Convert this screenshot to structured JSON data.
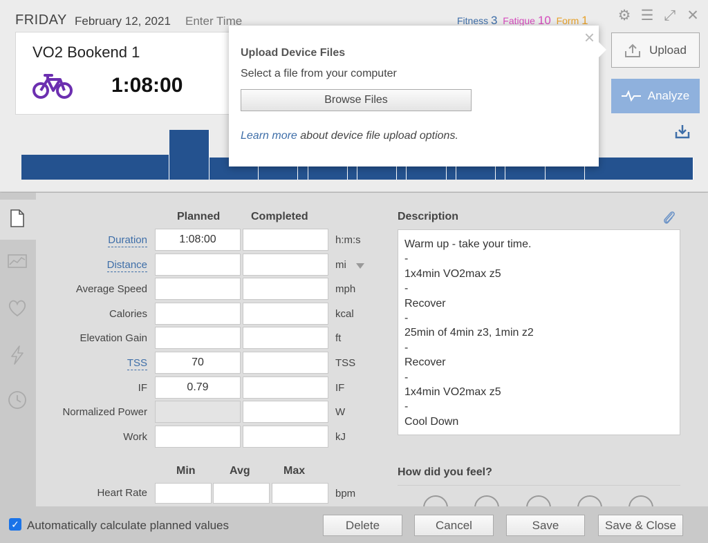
{
  "header": {
    "day": "FRIDAY",
    "date": "February 12, 2021",
    "time_placeholder": "Enter Time",
    "fitness_label": "Fitness",
    "fitness_value": "3",
    "fatigue_label": "Fatigue",
    "fatigue_value": "10",
    "form_label": "Form",
    "form_value": "1"
  },
  "workout": {
    "title": "VO2 Bookend 1",
    "duration": "1:08:00",
    "sport_icon": "bike-icon"
  },
  "actions": {
    "upload_label": "Upload",
    "analyze_label": "Analyze"
  },
  "popup": {
    "close": "×",
    "title": "Upload Device Files",
    "subtitle": "Select a file from your computer",
    "browse_label": "Browse Files",
    "learn_link": "Learn more",
    "learn_rest": " about device file upload options."
  },
  "form": {
    "planned_header": "Planned",
    "completed_header": "Completed",
    "rows": [
      {
        "label": "Duration",
        "planned": "1:08:00",
        "completed": "",
        "unit": "h:m:s"
      },
      {
        "label": "Distance",
        "planned": "",
        "completed": "",
        "unit": "mi"
      },
      {
        "label": "Average Speed",
        "planned": "",
        "completed": "",
        "unit": "mph"
      },
      {
        "label": "Calories",
        "planned": "",
        "completed": "",
        "unit": "kcal"
      },
      {
        "label": "Elevation Gain",
        "planned": "",
        "completed": "",
        "unit": "ft"
      },
      {
        "label": "TSS",
        "planned": "70",
        "completed": "",
        "unit": "TSS"
      },
      {
        "label": "IF",
        "planned": "0.79",
        "completed": "",
        "unit": "IF"
      },
      {
        "label": "Normalized Power",
        "planned": "",
        "completed": "",
        "unit": "W"
      },
      {
        "label": "Work",
        "planned": "",
        "completed": "",
        "unit": "kJ"
      }
    ],
    "min_header": "Min",
    "avg_header": "Avg",
    "max_header": "Max",
    "hr_label": "Heart Rate",
    "hr_unit": "bpm"
  },
  "description": {
    "header": "Description",
    "lines": [
      "Warm up - take your time.",
      "-",
      "1x4min VO2max z5",
      "-",
      "Recover",
      "-",
      "25min of 4min z3, 1min z2",
      "-",
      "Recover",
      "-",
      "1x4min VO2max z5",
      "-",
      "Cool Down"
    ],
    "feel_header": "How did you feel?"
  },
  "footer": {
    "auto_label": "Automatically calculate planned values",
    "delete_label": "Delete",
    "cancel_label": "Cancel",
    "save_label": "Save",
    "save_close_label": "Save & Close"
  },
  "colors": {
    "chart_bar": "#24528f",
    "analyze_bg": "#8fb1dd",
    "link": "#3e6ea8",
    "fitness": "#3e6ea8",
    "fatigue": "#d54bbd",
    "form": "#e7a12a",
    "bike": "#6c2fb0"
  },
  "chart_data": {
    "type": "bar",
    "x_unit": "minutes",
    "y_unit": "relative intensity",
    "bars": [
      {
        "start": 0,
        "end": 15,
        "value": 0.5
      },
      {
        "start": 15,
        "end": 19,
        "value": 1.0
      },
      {
        "start": 19,
        "end": 24,
        "value": 0.45
      },
      {
        "start": 24,
        "end": 28,
        "value": 0.55
      },
      {
        "start": 28,
        "end": 29,
        "value": 0.45
      },
      {
        "start": 29,
        "end": 33,
        "value": 0.55
      },
      {
        "start": 33,
        "end": 34,
        "value": 0.45
      },
      {
        "start": 34,
        "end": 38,
        "value": 0.55
      },
      {
        "start": 38,
        "end": 39,
        "value": 0.45
      },
      {
        "start": 39,
        "end": 43,
        "value": 0.55
      },
      {
        "start": 43,
        "end": 44,
        "value": 0.45
      },
      {
        "start": 44,
        "end": 48,
        "value": 0.55
      },
      {
        "start": 48,
        "end": 49,
        "value": 0.45
      },
      {
        "start": 49,
        "end": 53,
        "value": 0.5
      },
      {
        "start": 53,
        "end": 57,
        "value": 0.5
      },
      {
        "start": 57,
        "end": 68,
        "value": 0.45
      }
    ]
  }
}
